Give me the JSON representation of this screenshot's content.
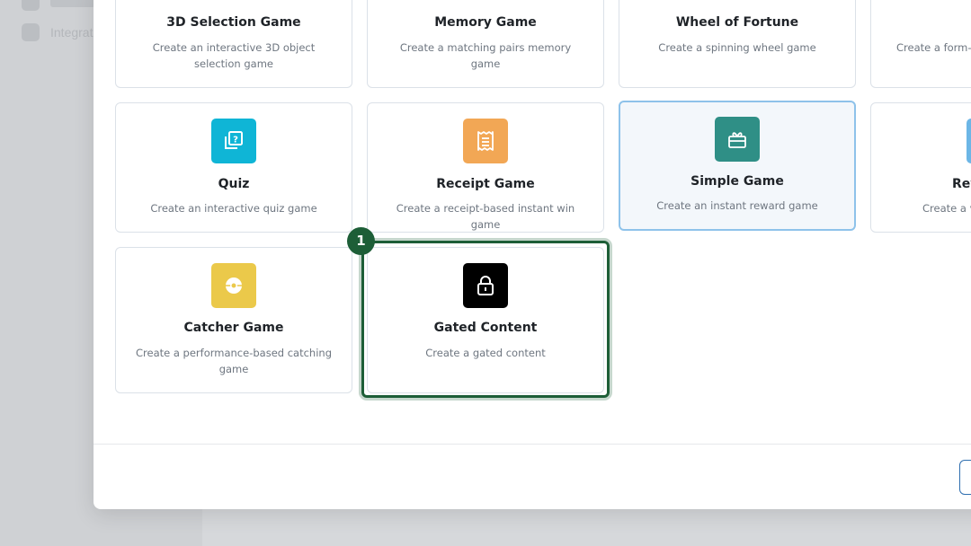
{
  "background": {
    "sidebar_items": [
      {
        "icon": "settings-icon"
      },
      {
        "icon": "integrations-icon",
        "label": "Integrat"
      }
    ]
  },
  "cards": {
    "selection3d": {
      "title": "3D Selection Game",
      "description": "Create an interactive 3D object selection game",
      "icon": "cube-icon",
      "color": "#7c5cd6"
    },
    "memory": {
      "title": "Memory Game",
      "description": "Create a matching pairs memory game",
      "icon": "cards-icon",
      "color": "#3fa37a"
    },
    "wheel": {
      "title": "Wheel of Fortune",
      "description": "Create a spinning wheel game",
      "icon": "wheel-icon",
      "color": "#e2544d"
    },
    "form": {
      "title": "",
      "description": "Create a form-b",
      "icon": "form-icon",
      "color": "#f0a04b"
    },
    "quiz": {
      "title": "Quiz",
      "description": "Create an interactive quiz game",
      "icon": "quiz-icon",
      "color": "#0fb5d6"
    },
    "receipt": {
      "title": "Receipt Game",
      "description": "Create a receipt-based instant win game",
      "icon": "receipt-icon",
      "color": "#f2a755"
    },
    "simple": {
      "title": "Simple Game",
      "description": "Create an instant reward game",
      "icon": "gift-icon",
      "color": "#2f8f86",
      "selected": true
    },
    "reveal": {
      "title": "Rev",
      "description": "Create a v",
      "icon": "reveal-icon",
      "color": "#6cb6e6"
    },
    "catcher": {
      "title": "Catcher Game",
      "description": "Create a performance-based catching game",
      "icon": "ball-icon",
      "color": "#ebc94a"
    },
    "gated": {
      "title": "Gated Content",
      "description": "Create a gated content",
      "icon": "lock-icon",
      "color": "#000000"
    }
  },
  "annotation": {
    "step": "1"
  },
  "footer": {
    "button_label": ""
  }
}
